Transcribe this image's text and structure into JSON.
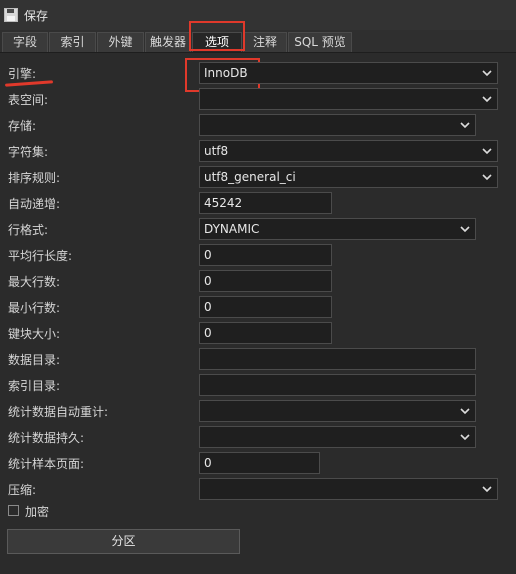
{
  "toolbar": {
    "save_label": "保存"
  },
  "tabs": [
    {
      "label": "字段"
    },
    {
      "label": "索引"
    },
    {
      "label": "外键"
    },
    {
      "label": "触发器"
    },
    {
      "label": "选项"
    },
    {
      "label": "注释"
    },
    {
      "label": "SQL 预览"
    }
  ],
  "active_tab": "选项",
  "options": {
    "engine": {
      "label": "引擎:",
      "value": "InnoDB"
    },
    "tablespace": {
      "label": "表空间:",
      "value": ""
    },
    "storage": {
      "label": "存储:",
      "value": ""
    },
    "charset": {
      "label": "字符集:",
      "value": "utf8"
    },
    "collation": {
      "label": "排序规则:",
      "value": "utf8_general_ci"
    },
    "auto_increment": {
      "label": "自动递增:",
      "value": "45242"
    },
    "row_format": {
      "label": "行格式:",
      "value": "DYNAMIC"
    },
    "avg_row_length": {
      "label": "平均行长度:",
      "value": "0"
    },
    "max_rows": {
      "label": "最大行数:",
      "value": "0"
    },
    "min_rows": {
      "label": "最小行数:",
      "value": "0"
    },
    "key_block_size": {
      "label": "键块大小:",
      "value": "0"
    },
    "data_directory": {
      "label": "数据目录:",
      "value": ""
    },
    "index_directory": {
      "label": "索引目录:",
      "value": ""
    },
    "stats_auto_recalc": {
      "label": "统计数据自动重计:",
      "value": ""
    },
    "stats_persistent": {
      "label": "统计数据持久:",
      "value": ""
    },
    "stats_sample_pages": {
      "label": "统计样本页面:",
      "value": "0"
    },
    "compression": {
      "label": "压缩:",
      "value": ""
    },
    "encryption": {
      "label": "加密",
      "checked": false
    }
  },
  "partition_button": {
    "label": "分区"
  },
  "colors": {
    "annotation": "#e0392b",
    "background": "#2b2b2b",
    "field_bg": "#1f1f1f"
  }
}
